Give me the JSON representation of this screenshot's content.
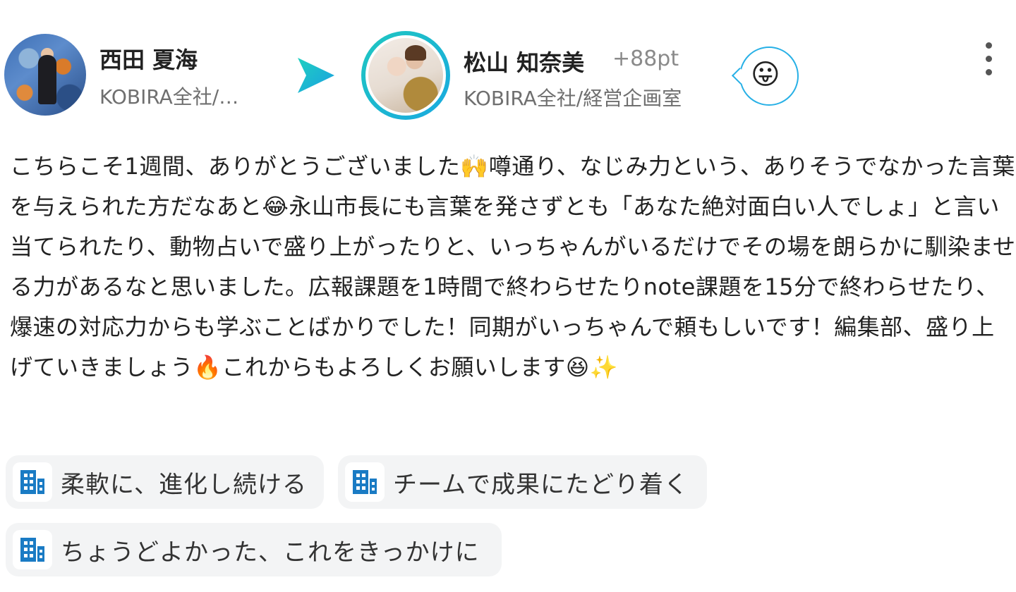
{
  "sender": {
    "name": "西田 夏海",
    "department": "KOBIRA全社/…"
  },
  "recipient": {
    "name": "松山 知奈美",
    "points": "+88pt",
    "department": "KOBIRA全社/経営企画室"
  },
  "reaction": {
    "emoji": "😛"
  },
  "message": {
    "text": "こちらこそ1週間、ありがとうございました🙌噂通り、なじみ力という、ありそうでなかった言葉を与えられた方だなあと😂永山市長にも言葉を発さずとも「あなた絶対面白い人でしょ」と言い当てられたり、動物占いで盛り上がったりと、いっちゃんがいるだけでその場を朗らかに馴染ませる力があるなと思いました。広報課題を1時間で終わらせたりnote課題を15分で終わらせたり、爆速の対応力からも学ぶことばかりでした！同期がいっちゃんで頼もしいです！編集部、盛り上げていきましょう🔥これからもよろしくお願いします😆✨"
  },
  "tags": [
    {
      "label": "柔軟に、進化し続ける",
      "icon": "building-icon"
    },
    {
      "label": "チームで成果にたどり着く",
      "icon": "building-icon"
    },
    {
      "label": "ちょうどよかった、これをきっかけに",
      "icon": "building-icon"
    }
  ],
  "colors": {
    "accent": "#19a9e0",
    "building_icon": "#1a7bc4",
    "tag_background": "#f3f4f5"
  }
}
